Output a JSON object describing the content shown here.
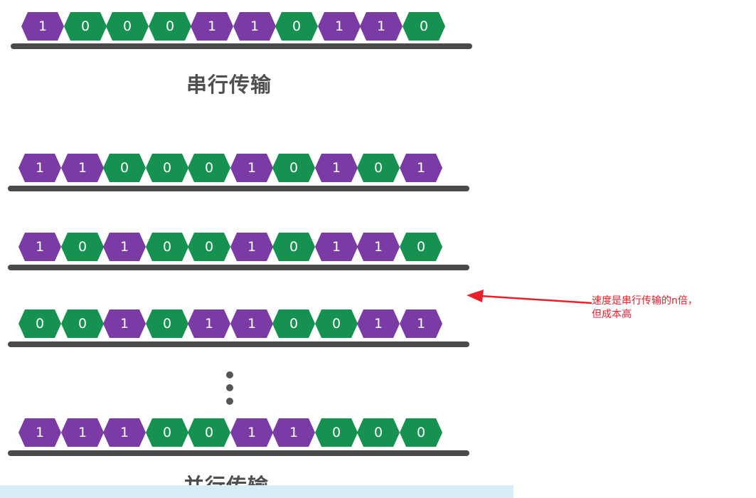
{
  "colors": {
    "one": "#7a3ba4",
    "zero": "#15924f",
    "rail": "#4a4a4a",
    "title": "#4f4f4f",
    "annotation": "#e8202a"
  },
  "serial": {
    "title": "串行传输",
    "bits": [
      "1",
      "0",
      "0",
      "0",
      "1",
      "1",
      "0",
      "1",
      "1",
      "0"
    ]
  },
  "parallel": {
    "title": "并行传输",
    "rows": [
      [
        "1",
        "1",
        "0",
        "0",
        "0",
        "1",
        "0",
        "1",
        "0",
        "1"
      ],
      [
        "1",
        "0",
        "1",
        "0",
        "0",
        "1",
        "0",
        "1",
        "1",
        "0"
      ],
      [
        "0",
        "0",
        "1",
        "0",
        "1",
        "1",
        "0",
        "0",
        "1",
        "1"
      ],
      [
        "1",
        "1",
        "1",
        "0",
        "0",
        "1",
        "1",
        "0",
        "0",
        "0"
      ]
    ]
  },
  "annotation": {
    "line1": "速度是串行传输的n倍，",
    "line2": "但成本高"
  }
}
